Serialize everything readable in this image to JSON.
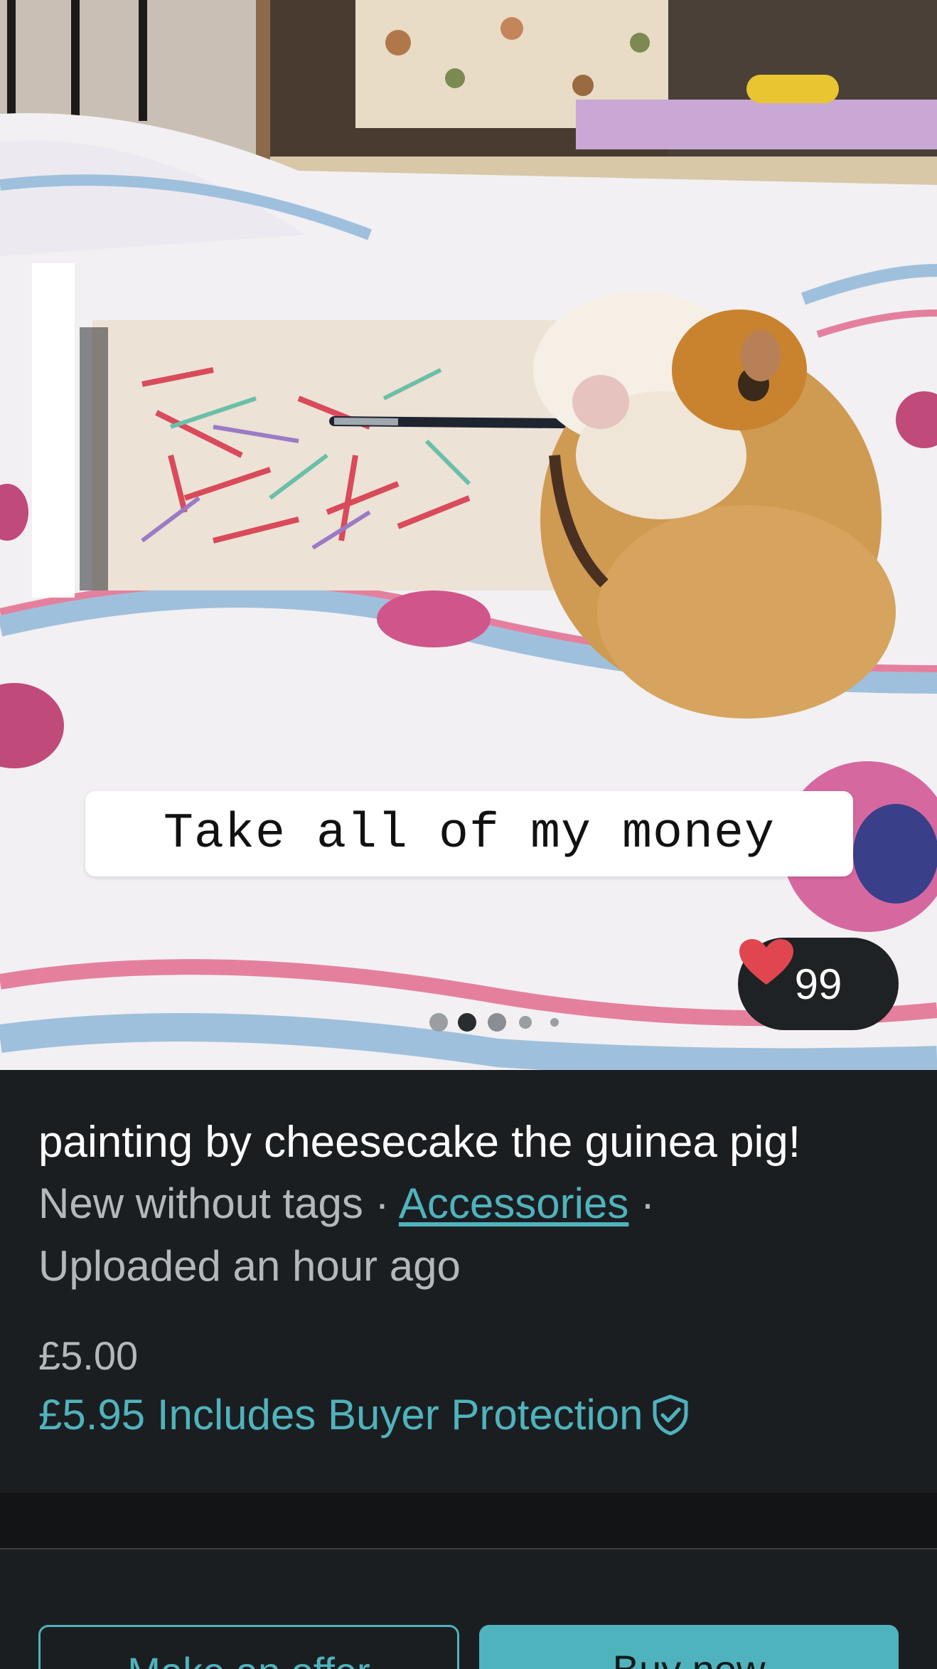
{
  "photo": {
    "caption": "Take all of my money",
    "likes": "99",
    "carousel_dots": 5,
    "active_dot": 2
  },
  "item": {
    "title": "painting by cheesecake the guinea pig!",
    "condition": "New without tags",
    "separator": " · ",
    "category": "Accessories",
    "uploaded": "Uploaded an hour ago",
    "price": "£5.00",
    "price_with_protection": "£5.95 Includes Buyer Protection"
  },
  "actions": {
    "make_offer": "Make an offer",
    "buy_now": "Buy now"
  },
  "colors": {
    "accent": "#4fb3bd",
    "heart": "#e0464f",
    "background": "#1b1e21"
  },
  "icons": {
    "like": "heart-icon",
    "protection": "shield-check-icon"
  }
}
